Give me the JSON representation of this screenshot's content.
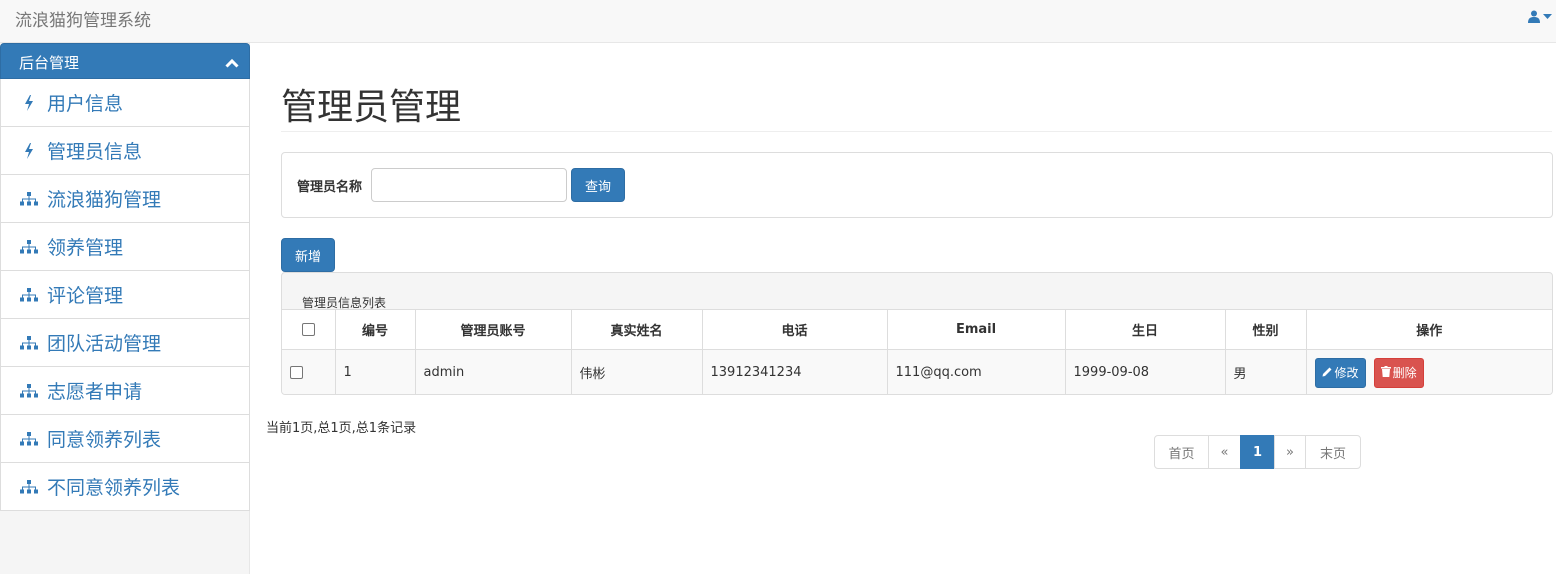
{
  "app": {
    "title": "流浪猫狗管理系统"
  },
  "sidebar": {
    "header": "后台管理",
    "items": [
      {
        "label": "用户信息",
        "icon": "bolt-icon"
      },
      {
        "label": "管理员信息",
        "icon": "bolt-icon"
      },
      {
        "label": "流浪猫狗管理",
        "icon": "sitemap-icon"
      },
      {
        "label": "领养管理",
        "icon": "sitemap-icon"
      },
      {
        "label": "评论管理",
        "icon": "sitemap-icon"
      },
      {
        "label": "团队活动管理",
        "icon": "sitemap-icon"
      },
      {
        "label": "志愿者申请",
        "icon": "sitemap-icon"
      },
      {
        "label": "同意领养列表",
        "icon": "sitemap-icon"
      },
      {
        "label": "不同意领养列表",
        "icon": "sitemap-icon"
      }
    ]
  },
  "main": {
    "title": "管理员管理",
    "search": {
      "label": "管理员名称",
      "value": "",
      "button": "查询"
    },
    "add_button": "新增",
    "table": {
      "caption": "管理员信息列表",
      "columns": [
        "编号",
        "管理员账号",
        "真实姓名",
        "电话",
        "Email",
        "生日",
        "性别",
        "操作"
      ],
      "rows": [
        {
          "id": "1",
          "account": "admin",
          "name": "伟彬",
          "phone": "13912341234",
          "email": "111@qq.com",
          "birthday": "1999-09-08",
          "gender": "男",
          "edit": "修改",
          "delete": "删除"
        }
      ]
    },
    "pagination": {
      "info": "当前1页,总1页,总1条记录",
      "first": "首页",
      "prev": "«",
      "current": "1",
      "next": "»",
      "last": "末页"
    }
  },
  "colors": {
    "primary": "#337ab7",
    "danger": "#d9534f",
    "navbar": "#f8f8f8"
  }
}
